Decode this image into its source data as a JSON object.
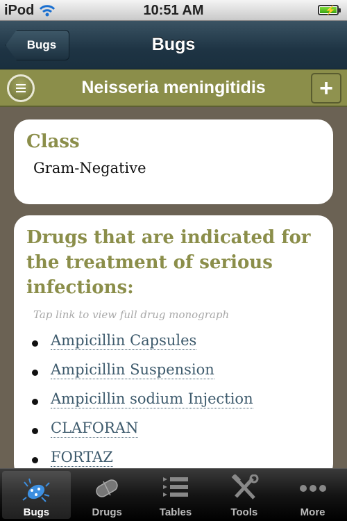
{
  "status_bar": {
    "carrier": "iPod",
    "time": "10:51 AM"
  },
  "nav": {
    "back_label": "Bugs",
    "title": "Bugs"
  },
  "bug_header": {
    "title": "Neisseria meningitidis",
    "add_label": "+"
  },
  "class_card": {
    "heading": "Class",
    "value": "Gram-Negative"
  },
  "drugs_card": {
    "heading": "Drugs that are indicated for the treatment of serious infections:",
    "hint": "Tap link to view full drug monograph",
    "items": [
      "Ampicillin Capsules",
      "Ampicillin Suspension",
      "Ampicillin sodium Injection",
      "CLAFORAN",
      "FORTAZ"
    ]
  },
  "tab_bar": {
    "tabs": [
      {
        "label": "Bugs",
        "icon": "bug-icon",
        "selected": true
      },
      {
        "label": "Drugs",
        "icon": "pill-icon",
        "selected": false
      },
      {
        "label": "Tables",
        "icon": "list-icon",
        "selected": false
      },
      {
        "label": "Tools",
        "icon": "tools-icon",
        "selected": false
      },
      {
        "label": "More",
        "icon": "more-icon",
        "selected": false
      }
    ]
  },
  "colors": {
    "accent": "#8b8e4a",
    "nav": "#1e3444",
    "link": "#3d5a6c",
    "background": "#6b6254"
  }
}
